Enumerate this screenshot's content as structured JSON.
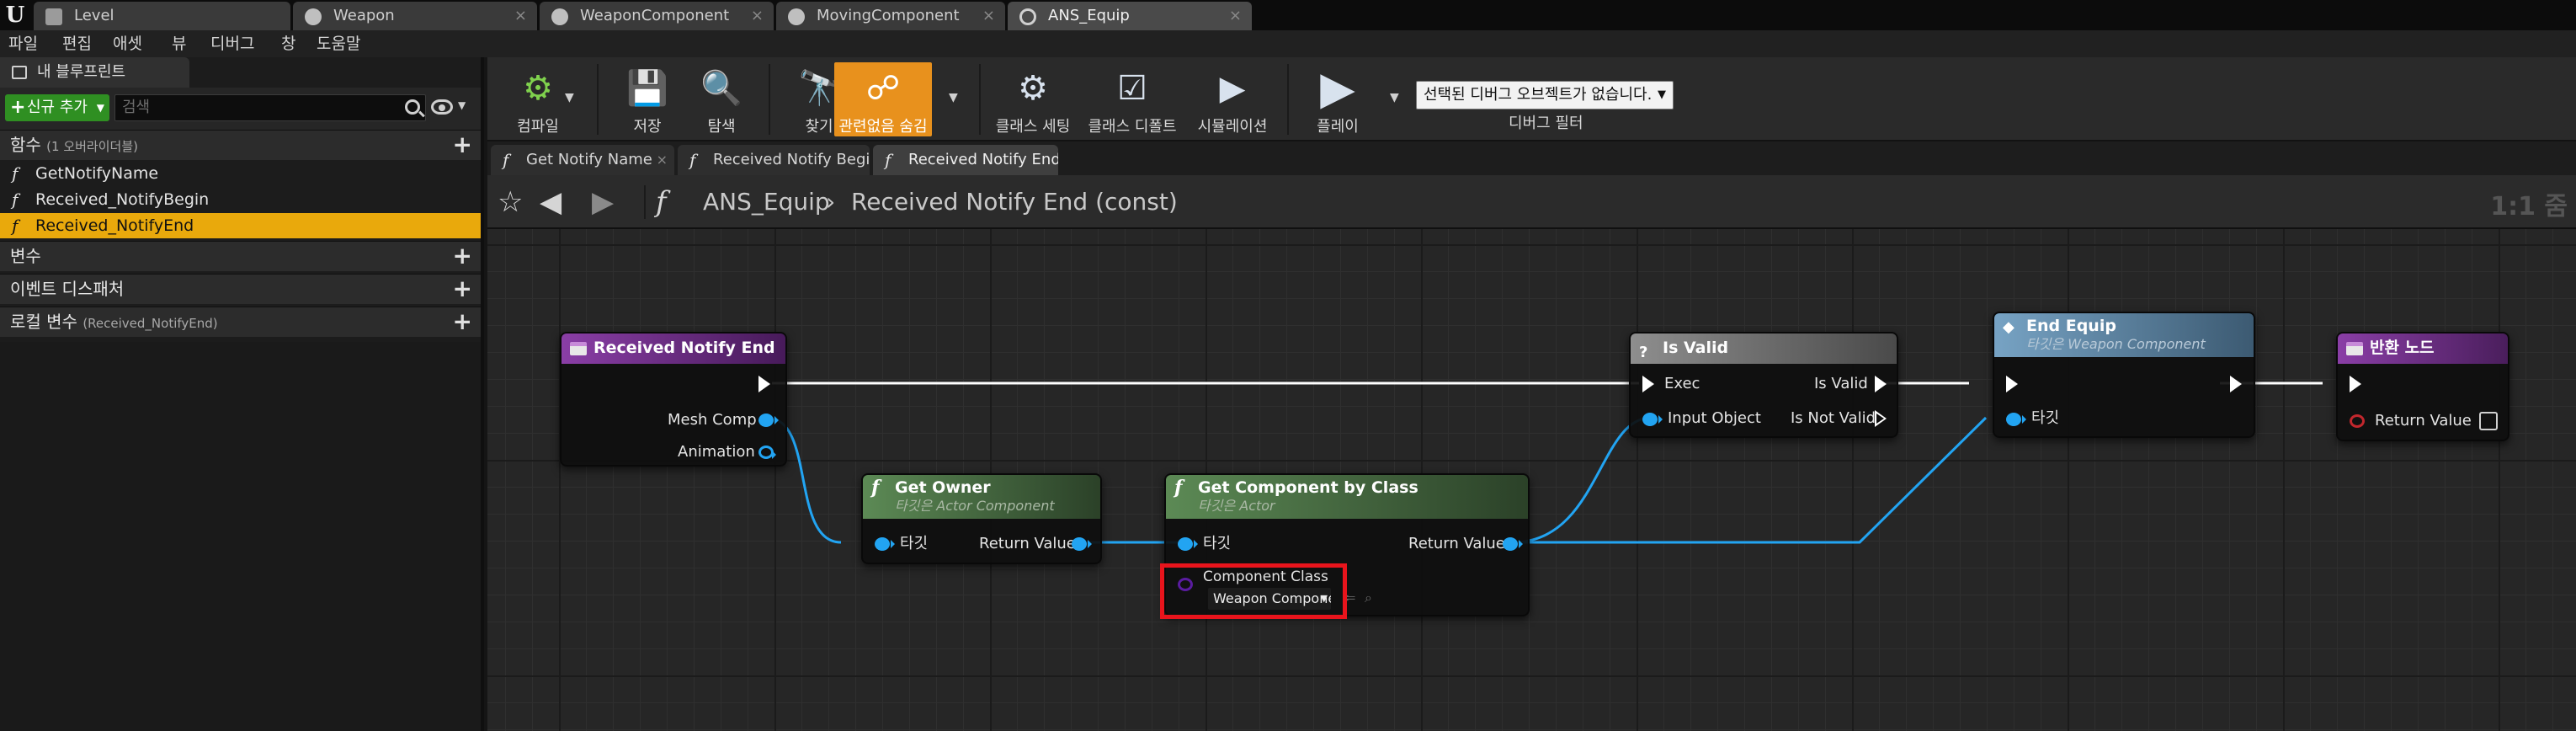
{
  "window_tabs": [
    "Level",
    "Weapon",
    "WeaponComponent",
    "MovingComponent",
    "ANS_Equip"
  ],
  "menu": [
    "파일",
    "편집",
    "애셋",
    "뷰",
    "디버그",
    "창",
    "도움말"
  ],
  "left_panel": {
    "tab_label": "내 블루프린트",
    "add_new_label": "신규 추가",
    "search_placeholder": "검색",
    "functions_header": "함수",
    "functions_sub": "(1 오버라이더블)",
    "functions": [
      "GetNotifyName",
      "Received_NotifyBegin",
      "Received_NotifyEnd"
    ],
    "variables_header": "변수",
    "dispatchers_header": "이벤트 디스패처",
    "local_vars_header": "로컬 변수",
    "local_vars_sub": "(Received_NotifyEnd)"
  },
  "toolbar": {
    "compile": "컴파일",
    "save": "저장",
    "browse": "탐색",
    "find": "찾기",
    "hide_unrelated": "관련없음 숨김",
    "class_settings": "클래스 세팅",
    "class_defaults": "클래스 디폴트",
    "simulation": "시뮬레이션",
    "play": "플레이",
    "debug_object": "선택된 디버그 오브젝트가 없습니다.",
    "debug_filter": "디버그 필터"
  },
  "doc_tabs": [
    "Get Notify Name",
    "Received Notify Begin",
    "Received Notify End"
  ],
  "breadcrumb": {
    "root": "ANS_Equip",
    "current": "Received Notify End (const)",
    "zoom": "1:1 줌"
  },
  "graph": {
    "event_node": {
      "title": "Received Notify End",
      "pin_mesh": "Mesh Comp",
      "pin_anim": "Animation"
    },
    "get_owner": {
      "title": "Get Owner",
      "subtitle": "타깃은 Actor Component",
      "pin_target": "타깃",
      "pin_return": "Return Value"
    },
    "get_component": {
      "title": "Get Component by Class",
      "subtitle": "타깃은 Actor",
      "pin_target": "타깃",
      "pin_return": "Return Value",
      "pin_class": "Component Class",
      "class_value": "Weapon Component"
    },
    "is_valid": {
      "title": "Is Valid",
      "pin_exec": "Exec",
      "pin_input": "Input Object",
      "pin_valid": "Is Valid",
      "pin_not_valid": "Is Not Valid"
    },
    "end_equip": {
      "title": "End Equip",
      "subtitle": "타깃은 Weapon Component",
      "pin_target": "타깃"
    },
    "return_node": {
      "title": "반환 노드",
      "pin_return": "Return Value"
    }
  },
  "colors": {
    "accent_orange": "#e8911d",
    "selected_row": "#e9a90c",
    "object_pin": "#22a4f2",
    "class_pin": "#5a1ca0",
    "highlight": "#e8141c"
  }
}
